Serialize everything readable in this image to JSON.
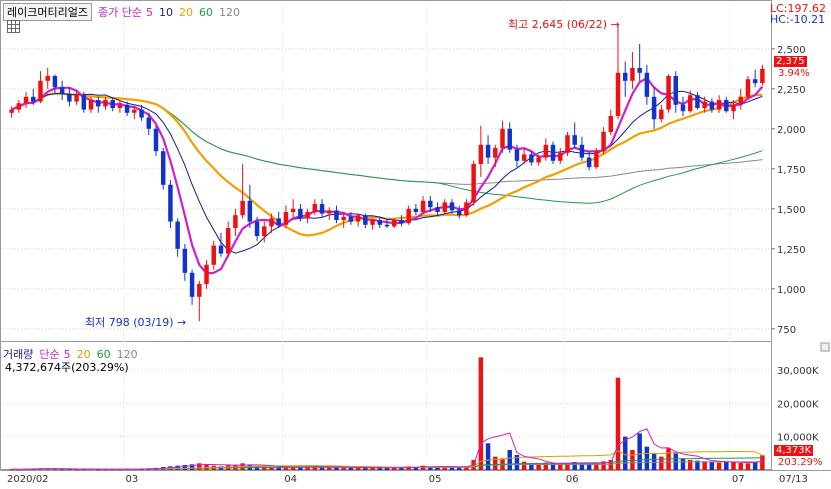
{
  "header": {
    "stock_name": "레이크머티리얼즈",
    "price_legend_prefix": "종가 단순",
    "ma_labels": [
      "5",
      "10",
      "20",
      "60",
      "120"
    ],
    "lc_label": "LC:197.62",
    "hc_label": "HC:-10.21"
  },
  "annotations": {
    "high_label": "최고 2,645 (06/22)",
    "low_label": "최저 798 (03/19)"
  },
  "price_tags": {
    "last_price": "2,375",
    "last_change": "3.94%"
  },
  "volume_header": {
    "title": "거래량",
    "prefix": "단순",
    "ma_labels": [
      "5",
      "20",
      "60",
      "120"
    ],
    "current": "4,372,674주(203.29%)"
  },
  "volume_tags": {
    "last_volume": "4,373K",
    "last_ratio": "203.29%"
  },
  "colors": {
    "up": "#ee1111",
    "down": "#1133cc",
    "ma5": "#cc22cc",
    "ma10": "#1a1a8a",
    "ma20": "#f0a000",
    "ma60": "#229944",
    "ma120": "#888888",
    "vol_ma5": "#cc22cc",
    "vol_ma20": "#d4a000",
    "vol_ma60": "#229944",
    "vol_ma120": "#888888"
  },
  "chart_data": {
    "type": "candlestick",
    "y_ticks": [
      "2,500",
      "2,250",
      "2,000",
      "1,750",
      "1,500",
      "1,250",
      "1,000",
      "750"
    ],
    "y_values": [
      2500,
      2250,
      2000,
      1750,
      1500,
      1250,
      1000,
      750
    ],
    "ylim": [
      680,
      2680
    ],
    "x_labels": [
      "2020/02",
      "03",
      "04",
      "05",
      "06",
      "07",
      "07/13"
    ],
    "x_label_index": [
      0,
      16,
      38,
      58,
      77,
      100,
      112
    ],
    "vol_y_ticks": [
      "30,000K",
      "20,000K",
      "10,000K"
    ],
    "vol_y_values": [
      30000,
      20000,
      10000
    ],
    "vol_ylim": [
      0,
      36000
    ],
    "candles": [
      [
        2100,
        2140,
        2070,
        2120
      ],
      [
        2120,
        2180,
        2100,
        2160
      ],
      [
        2160,
        2230,
        2130,
        2200
      ],
      [
        2200,
        2250,
        2150,
        2170
      ],
      [
        2170,
        2360,
        2160,
        2300
      ],
      [
        2300,
        2380,
        2250,
        2330
      ],
      [
        2330,
        2340,
        2220,
        2260
      ],
      [
        2260,
        2300,
        2180,
        2220
      ],
      [
        2220,
        2260,
        2140,
        2170
      ],
      [
        2170,
        2240,
        2150,
        2210
      ],
      [
        2210,
        2230,
        2100,
        2120
      ],
      [
        2120,
        2200,
        2100,
        2180
      ],
      [
        2180,
        2200,
        2100,
        2140
      ],
      [
        2140,
        2200,
        2120,
        2180
      ],
      [
        2180,
        2190,
        2110,
        2130
      ],
      [
        2130,
        2180,
        2100,
        2150
      ],
      [
        2150,
        2170,
        2080,
        2100
      ],
      [
        2100,
        2140,
        2060,
        2120
      ],
      [
        2120,
        2150,
        2050,
        2070
      ],
      [
        2070,
        2100,
        1960,
        2000
      ],
      [
        2000,
        2020,
        1830,
        1860
      ],
      [
        1860,
        1880,
        1620,
        1650
      ],
      [
        1650,
        1680,
        1380,
        1420
      ],
      [
        1420,
        1440,
        1200,
        1250
      ],
      [
        1250,
        1280,
        1050,
        1100
      ],
      [
        1100,
        1120,
        900,
        950
      ],
      [
        950,
        1050,
        798,
        1030
      ],
      [
        1030,
        1180,
        1000,
        1150
      ],
      [
        1150,
        1300,
        1120,
        1270
      ],
      [
        1270,
        1350,
        1200,
        1220
      ],
      [
        1220,
        1420,
        1200,
        1380
      ],
      [
        1380,
        1500,
        1330,
        1460
      ],
      [
        1460,
        1780,
        1440,
        1550
      ],
      [
        1550,
        1650,
        1380,
        1420
      ],
      [
        1420,
        1450,
        1300,
        1330
      ],
      [
        1330,
        1420,
        1290,
        1390
      ],
      [
        1390,
        1470,
        1350,
        1440
      ],
      [
        1440,
        1480,
        1380,
        1400
      ],
      [
        1400,
        1520,
        1380,
        1480
      ],
      [
        1480,
        1560,
        1450,
        1500
      ],
      [
        1500,
        1530,
        1420,
        1440
      ],
      [
        1440,
        1500,
        1410,
        1480
      ],
      [
        1480,
        1560,
        1460,
        1530
      ],
      [
        1530,
        1560,
        1450,
        1470
      ],
      [
        1470,
        1510,
        1430,
        1490
      ],
      [
        1490,
        1520,
        1410,
        1430
      ],
      [
        1430,
        1470,
        1380,
        1450
      ],
      [
        1450,
        1480,
        1400,
        1420
      ],
      [
        1420,
        1470,
        1390,
        1460
      ],
      [
        1460,
        1470,
        1380,
        1400
      ],
      [
        1400,
        1440,
        1370,
        1430
      ],
      [
        1430,
        1450,
        1380,
        1400
      ],
      [
        1400,
        1430,
        1380,
        1390
      ],
      [
        1390,
        1440,
        1380,
        1430
      ],
      [
        1430,
        1460,
        1390,
        1410
      ],
      [
        1410,
        1520,
        1400,
        1500
      ],
      [
        1500,
        1530,
        1460,
        1480
      ],
      [
        1480,
        1580,
        1470,
        1550
      ],
      [
        1550,
        1580,
        1480,
        1510
      ],
      [
        1510,
        1540,
        1460,
        1480
      ],
      [
        1480,
        1560,
        1470,
        1540
      ],
      [
        1540,
        1560,
        1470,
        1490
      ],
      [
        1490,
        1520,
        1440,
        1460
      ],
      [
        1460,
        1560,
        1450,
        1540
      ],
      [
        1540,
        1800,
        1520,
        1780
      ],
      [
        1780,
        2020,
        1700,
        1900
      ],
      [
        1900,
        1960,
        1780,
        1820
      ],
      [
        1820,
        1900,
        1760,
        1880
      ],
      [
        1880,
        2050,
        1850,
        2000
      ],
      [
        2000,
        2040,
        1850,
        1870
      ],
      [
        1870,
        1900,
        1760,
        1800
      ],
      [
        1800,
        1880,
        1780,
        1840
      ],
      [
        1840,
        1860,
        1770,
        1790
      ],
      [
        1790,
        1840,
        1770,
        1820
      ],
      [
        1820,
        1940,
        1800,
        1900
      ],
      [
        1900,
        1920,
        1780,
        1800
      ],
      [
        1800,
        1880,
        1780,
        1850
      ],
      [
        1850,
        1980,
        1830,
        1960
      ],
      [
        1960,
        2040,
        1880,
        1900
      ],
      [
        1900,
        1950,
        1800,
        1820
      ],
      [
        1820,
        1860,
        1740,
        1760
      ],
      [
        1760,
        1880,
        1750,
        1860
      ],
      [
        1860,
        2010,
        1840,
        1980
      ],
      [
        1980,
        2120,
        1960,
        2080
      ],
      [
        2080,
        2645,
        2060,
        2350
      ],
      [
        2350,
        2420,
        2200,
        2300
      ],
      [
        2300,
        2480,
        2250,
        2380
      ],
      [
        2380,
        2530,
        2300,
        2350
      ],
      [
        2350,
        2400,
        2150,
        2200
      ],
      [
        2200,
        2260,
        2000,
        2060
      ],
      [
        2060,
        2150,
        2040,
        2120
      ],
      [
        2120,
        2340,
        2100,
        2330
      ],
      [
        2330,
        2360,
        2100,
        2150
      ],
      [
        2150,
        2200,
        2080,
        2110
      ],
      [
        2110,
        2240,
        2100,
        2210
      ],
      [
        2210,
        2230,
        2120,
        2130
      ],
      [
        2130,
        2200,
        2100,
        2170
      ],
      [
        2170,
        2190,
        2100,
        2120
      ],
      [
        2120,
        2210,
        2100,
        2180
      ],
      [
        2180,
        2200,
        2100,
        2110
      ],
      [
        2110,
        2180,
        2060,
        2150
      ],
      [
        2150,
        2250,
        2120,
        2200
      ],
      [
        2200,
        2330,
        2180,
        2310
      ],
      [
        2310,
        2370,
        2260,
        2285
      ],
      [
        2285,
        2400,
        2270,
        2375
      ]
    ],
    "volume": [
      200,
      180,
      350,
      420,
      500,
      380,
      300,
      250,
      280,
      220,
      260,
      300,
      240,
      200,
      260,
      220,
      300,
      280,
      400,
      500,
      650,
      900,
      1100,
      1300,
      1500,
      1700,
      2000,
      1800,
      1300,
      1100,
      1400,
      1600,
      2000,
      1500,
      1200,
      1000,
      900,
      800,
      1100,
      1000,
      950,
      900,
      1200,
      1000,
      800,
      750,
      700,
      650,
      700,
      680,
      660,
      640,
      600,
      700,
      650,
      1100,
      900,
      1300,
      1000,
      800,
      1200,
      1000,
      900,
      1100,
      3000,
      33800,
      8000,
      4000,
      3500,
      6000,
      4500,
      2500,
      2000,
      1800,
      2200,
      2000,
      1600,
      1800,
      2400,
      2000,
      1700,
      1900,
      2600,
      3000,
      27700,
      10000,
      6000,
      11000,
      7000,
      5000,
      4000,
      6500,
      5000,
      3500,
      3000,
      2800,
      2600,
      2400,
      2200,
      2500,
      2300,
      2100,
      2000,
      2400,
      4373
    ]
  }
}
